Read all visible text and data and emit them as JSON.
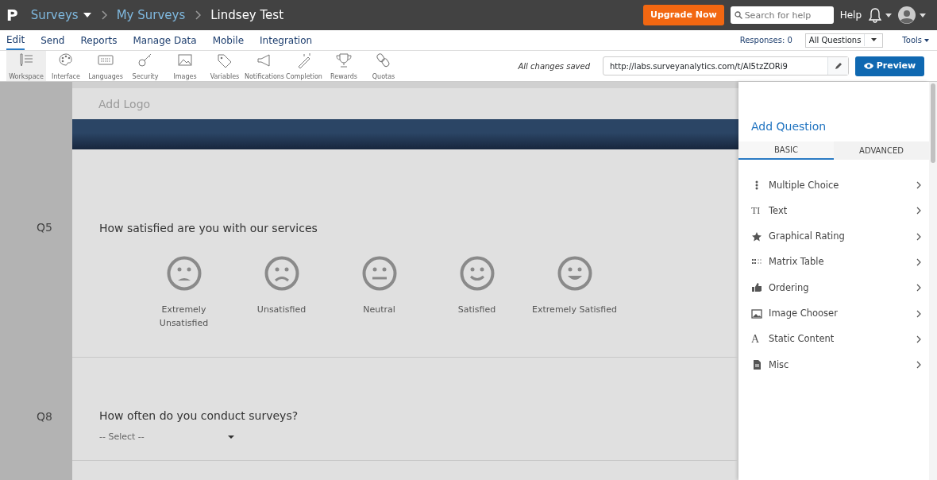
{
  "topbar": {
    "logo": "P",
    "breadcrumbs": [
      {
        "label": "Surveys",
        "dropdown": true
      },
      {
        "label": "My Surveys",
        "dropdown": false
      },
      {
        "label": "Lindsey Test",
        "dropdown": false
      }
    ],
    "upgrade_button": "Upgrade Now",
    "search": {
      "placeholder": "Search for help"
    },
    "help": "Help"
  },
  "menu": {
    "items": [
      {
        "label": "Edit",
        "selected": true
      },
      {
        "label": "Send",
        "selected": false
      },
      {
        "label": "Reports",
        "selected": false
      },
      {
        "label": "Manage Data",
        "selected": false
      },
      {
        "label": "Mobile",
        "selected": false
      },
      {
        "label": "Integration",
        "selected": false
      }
    ],
    "responses": "Responses: 0",
    "filter": "All Questions",
    "tools": "Tools"
  },
  "toolbar": {
    "items": [
      {
        "label": "Workspace",
        "kind": "workspace",
        "selected": true
      },
      {
        "label": "Interface",
        "kind": "palette",
        "selected": false
      },
      {
        "label": "Languages",
        "kind": "keyboard",
        "selected": false
      },
      {
        "label": "Security",
        "kind": "key",
        "selected": false
      },
      {
        "label": "Images",
        "kind": "image",
        "selected": false
      },
      {
        "label": "Variables",
        "kind": "tag",
        "selected": false
      },
      {
        "label": "Notifications",
        "kind": "megaphone",
        "selected": false
      },
      {
        "label": "Completion",
        "kind": "wand",
        "selected": false
      },
      {
        "label": "Rewards",
        "kind": "trophy",
        "selected": false
      },
      {
        "label": "Quotas",
        "kind": "link",
        "selected": false
      }
    ],
    "save_status": "All changes saved",
    "url": "http://labs.surveyanalytics.com/t/AI5tzZORi9",
    "preview_button": "Preview"
  },
  "survey": {
    "logo_placeholder": "Add Logo",
    "questions": [
      {
        "number": "Q5",
        "text": "How satisfied are you with our services",
        "kind": "smiley",
        "options": [
          {
            "label": "Extremely Unsatisfied",
            "kind": "very-sad"
          },
          {
            "label": "Unsatisfied",
            "kind": "sad"
          },
          {
            "label": "Neutral",
            "kind": "neutral"
          },
          {
            "label": "Satisfied",
            "kind": "happy"
          },
          {
            "label": "Extremely Satisfied",
            "kind": "very-happy"
          }
        ]
      },
      {
        "number": "Q8",
        "text": "How often do you conduct surveys?",
        "kind": "dropdown",
        "select": "-- Select --"
      }
    ]
  },
  "panel": {
    "title": "Add Question",
    "tabs": [
      {
        "label": "BASIC",
        "selected": true
      },
      {
        "label": "ADVANCED",
        "selected": false
      }
    ],
    "items": [
      {
        "label": "Multiple Choice",
        "kind": "dots"
      },
      {
        "label": "Text",
        "kind": "text",
        "glyph": "TI"
      },
      {
        "label": "Graphical Rating",
        "kind": "star"
      },
      {
        "label": "Matrix Table",
        "kind": "grid"
      },
      {
        "label": "Ordering",
        "kind": "thumb"
      },
      {
        "label": "Image Chooser",
        "kind": "image"
      },
      {
        "label": "Static Content",
        "kind": "letter",
        "glyph": "A"
      },
      {
        "label": "Misc",
        "kind": "file"
      }
    ]
  }
}
